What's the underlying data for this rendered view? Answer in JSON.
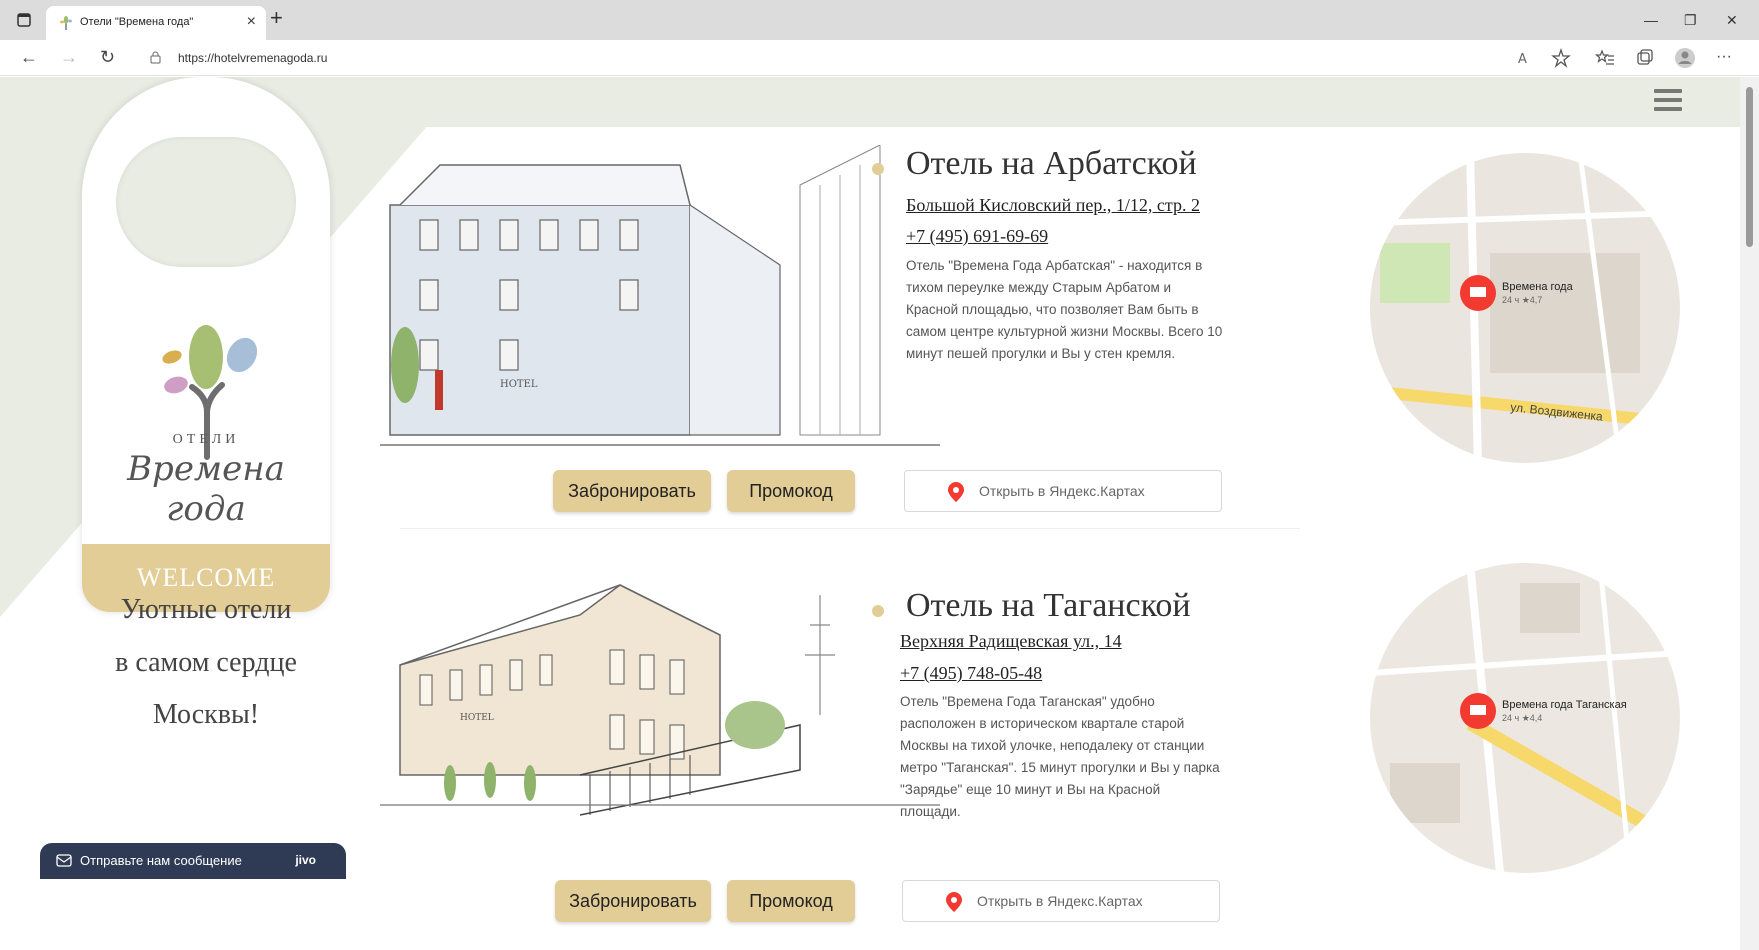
{
  "browser": {
    "tab_title": "Отели \"Времена года\"",
    "url": "https://hotelvremenagoda.ru"
  },
  "brand": {
    "small": "ОТЕЛИ",
    "script": "Времена года",
    "welcome": "WELCOME",
    "colors": {
      "gold": "#e2cd96",
      "sage": "#e8ece3"
    }
  },
  "slogan": [
    "Уютные отели",
    "в самом сердце",
    "Москвы!"
  ],
  "hotels": [
    {
      "title": "Отель на Арбатской",
      "address": "Большой Кисловский пер., 1/12, стр. 2",
      "phone": "+7 (495) 691-69-69",
      "description": "Отель \"Времена Года Арбатская\" - находится в тихом переулке между Старым Арбатом и Красной площадью, что позволяет Вам быть в самом центре культурной жизни Москвы. Всего 10 минут пешей прогулки и Вы у стен кремля.",
      "book_label": "Забронировать",
      "promo_label": "Промокод",
      "map_label": "Открыть в Яндекс.Картах",
      "map": {
        "place": "Времена года",
        "rating": "24 ч ★4,7",
        "street": "ул. Воздвиженка"
      }
    },
    {
      "title": "Отель на Таганской",
      "address": "Верхняя Радищевская ул., 14",
      "phone": "+7 (495) 748-05-48",
      "description": "Отель \"Времена Года Таганская\" удобно расположен в историческом квартале старой Москвы на тихой улочке, неподалеку от станции метро \"Таганская\". 15 минут прогулки и Вы у парка \"Зарядье\" еще 10 минут и Вы на Красной площади.",
      "book_label": "Забронировать",
      "promo_label": "Промокод",
      "map_label": "Открыть в Яндекс.Картах",
      "map": {
        "place": "Времена года Таганская",
        "rating": "24 ч ★4,4",
        "street": ""
      }
    }
  ],
  "chat": {
    "label": "Отправьте нам сообщение",
    "brand": "jivo"
  }
}
